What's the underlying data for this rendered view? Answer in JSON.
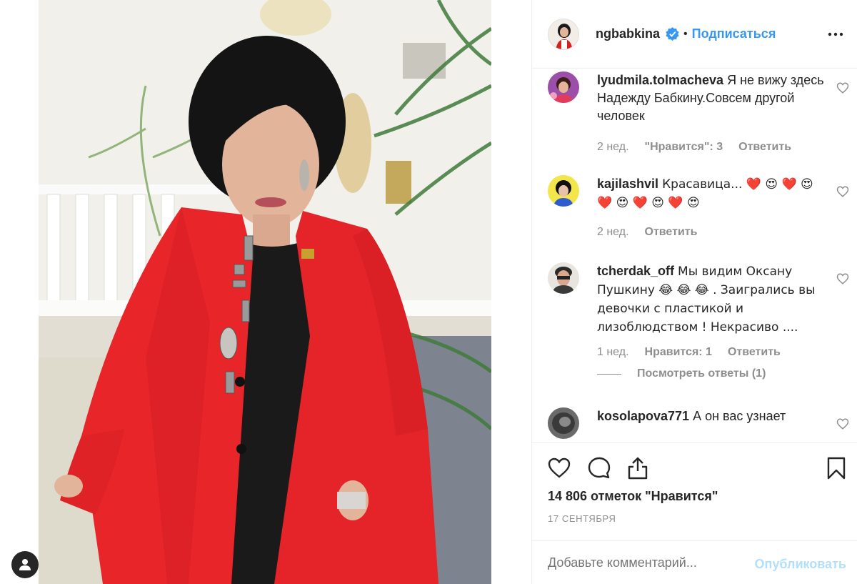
{
  "post": {
    "username": "ngbabkina",
    "dot": "•",
    "follow_label": "Подписаться",
    "likes_text": "14 806 отметок \"Нравится\"",
    "date_text": "17 СЕНТЯБРЯ"
  },
  "comments": [
    {
      "user": "lyudmila.tolmacheva",
      "text": "Я не вижу здесь Надежду Бабкину.Совсем другой человек",
      "time": "2 нед.",
      "likes": "\"Нравится\": 3",
      "reply": "Ответить"
    },
    {
      "user": "kajilashvil",
      "text": "Красавица... ❤️ 😍 ❤️ 😍 ❤️ 😍 ❤️ 😍 ❤️ 😍",
      "time": "2 нед.",
      "reply": "Ответить"
    },
    {
      "user": "tcherdak_off",
      "text": "Мы видим Оксану Пушкину 😂 😂 😂  . Заигрались вы девочки с пластикой и лизоблюдством ! Некрасиво ....",
      "time": "1 нед.",
      "likes": "Нравится: 1",
      "reply": "Ответить",
      "view_replies": "Посмотреть ответы (1)"
    },
    {
      "user": "kosolapova771",
      "text": "А он вас узнает"
    }
  ],
  "add_comment": {
    "placeholder": "Добавьте комментарий...",
    "publish_label": "Опубликовать"
  },
  "colors": {
    "accent": "#3897f0",
    "publish_disabled": "#b2dffc",
    "meta_gray": "#8e8e8e",
    "jacket_red": "#e8262a"
  },
  "icons": [
    "user-tag-icon",
    "verified-badge-icon",
    "more-options-icon",
    "heart-icon",
    "comment-icon",
    "share-icon",
    "bookmark-icon"
  ]
}
